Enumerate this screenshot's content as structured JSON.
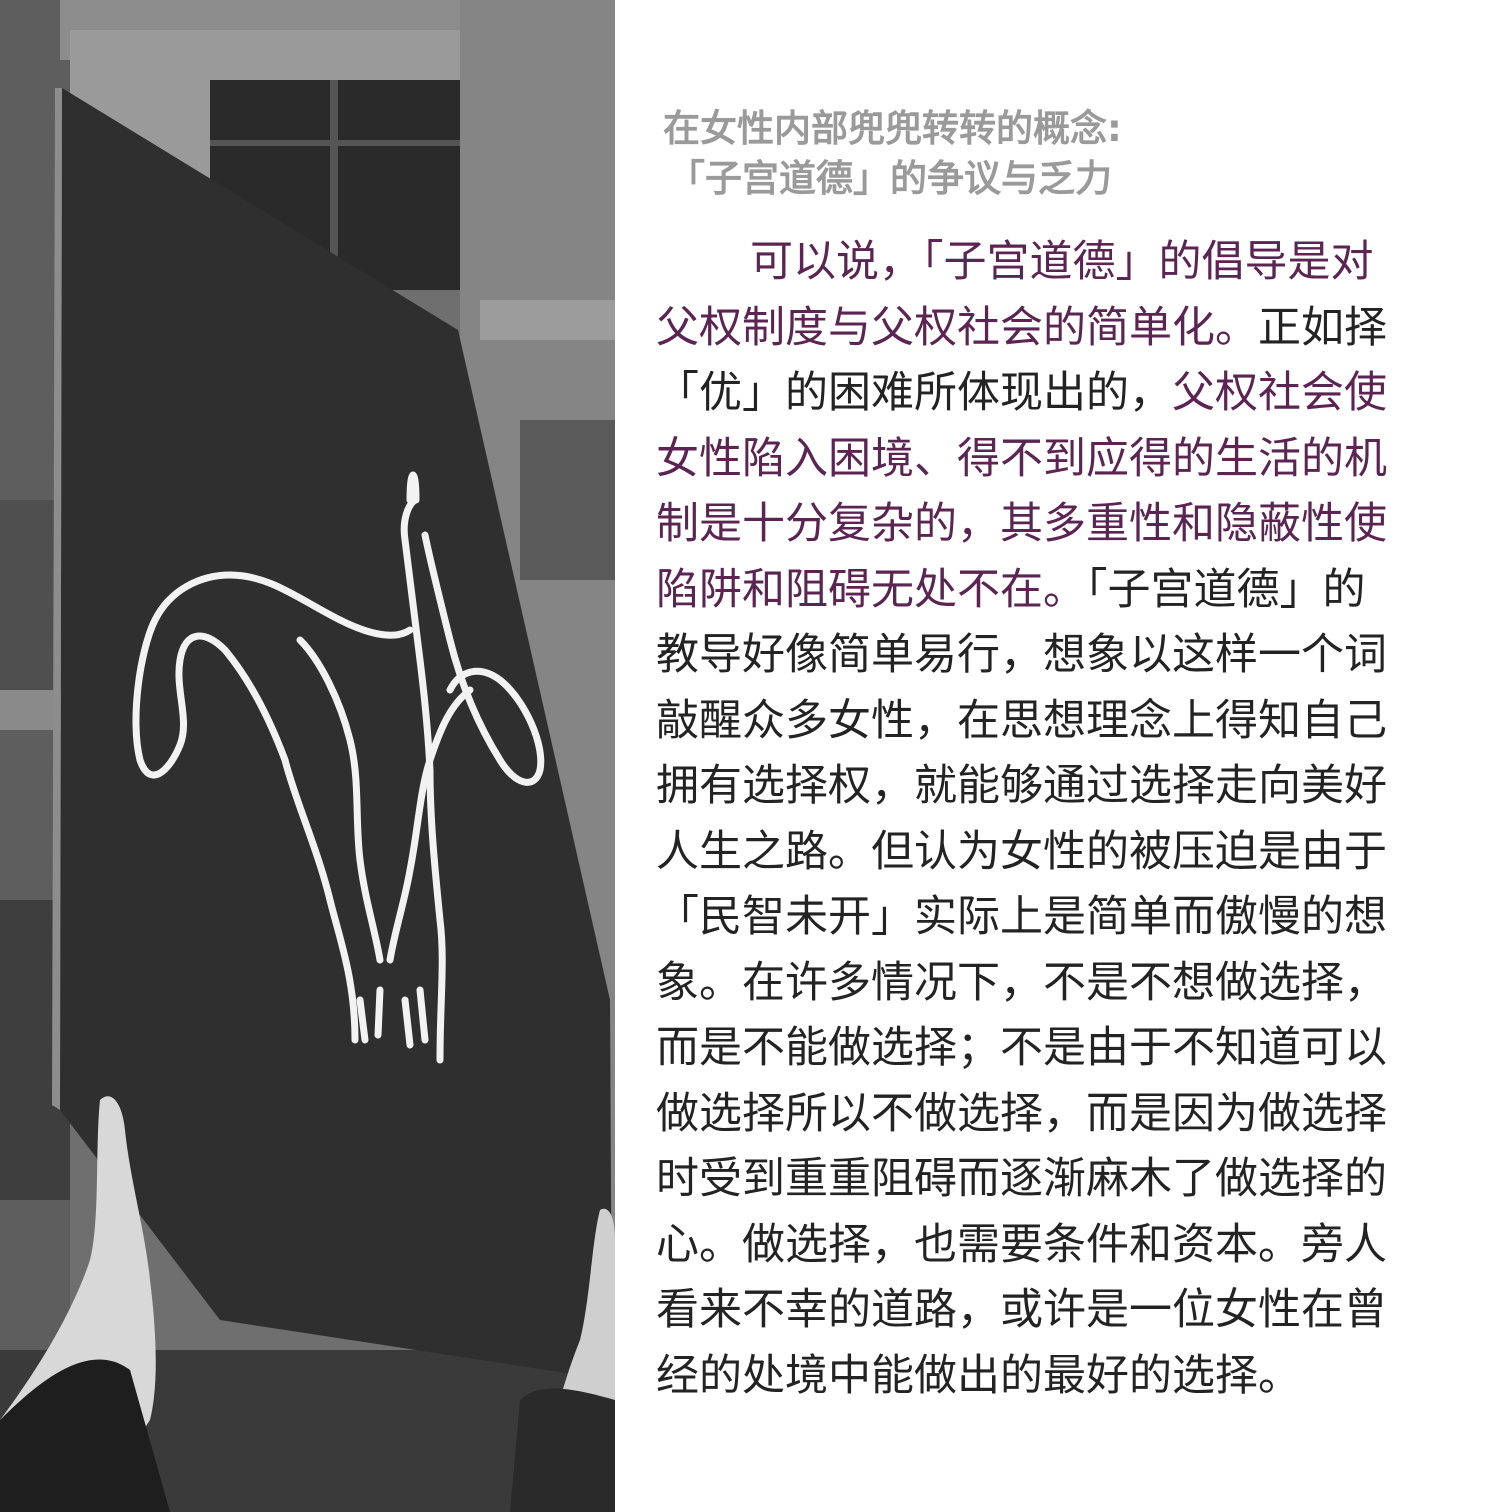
{
  "article": {
    "title_line1": "在女性内部兜兜转转的概念:",
    "title_line2": "「子宫道德」的争议与乏力",
    "body_lines": [
      [
        {
          "t": "可以说，「子宫道德」的倡导是对",
          "hl": true
        }
      ],
      [
        {
          "t": "父权制度与父权社会的简单化。",
          "hl": true
        },
        {
          "t": "正如择",
          "hl": false
        }
      ],
      [
        {
          "t": "「优」的困难所体现出的，",
          "hl": false
        },
        {
          "t": "父权社会使",
          "hl": true
        }
      ],
      [
        {
          "t": "女性陷入困境、得不到应得的生活的机",
          "hl": true
        }
      ],
      [
        {
          "t": "制是十分复杂的，其多重性和隐蔽性使",
          "hl": true
        }
      ],
      [
        {
          "t": "陷阱和阻碍无处不在。",
          "hl": true
        },
        {
          "t": "「子宫道德」的",
          "hl": false
        }
      ],
      [
        {
          "t": "教导好像简单易行，想象以这样一个词",
          "hl": false
        }
      ],
      [
        {
          "t": "敲醒众多女性，在思想理念上得知自己",
          "hl": false
        }
      ],
      [
        {
          "t": "拥有选择权，就能够通过选择走向美好",
          "hl": false
        }
      ],
      [
        {
          "t": "人生之路。但认为女性的被压迫是由于",
          "hl": false
        }
      ],
      [
        {
          "t": "「民智未开」实际上是简单而傲慢的想",
          "hl": false
        }
      ],
      [
        {
          "t": "象。在许多情况下，不是不想做选择，",
          "hl": false
        }
      ],
      [
        {
          "t": "而是不能做选择；不是由于不知道可以",
          "hl": false
        }
      ],
      [
        {
          "t": "做选择所以不做选择，而是因为做选择",
          "hl": false
        }
      ],
      [
        {
          "t": "时受到重重阻碍而逐渐麻木了做选择的",
          "hl": false
        }
      ],
      [
        {
          "t": "心。做选择，也需要条件和资本。旁人",
          "hl": false
        }
      ],
      [
        {
          "t": "看来不幸的道路，或许是一位女性在曾",
          "hl": false
        }
      ],
      [
        {
          "t": "经的处境中能做出的最好的选择。",
          "hl": false
        }
      ]
    ]
  },
  "photo": {
    "description_icon": "protest-sign-uterus-drawing",
    "tone": "black-and-white"
  },
  "colors": {
    "title": "#9a9a9a",
    "body": "#232323",
    "highlight": "#5c2452",
    "sign_board": "#2f2f2f",
    "sign_drawing": "#f2f2f2"
  }
}
